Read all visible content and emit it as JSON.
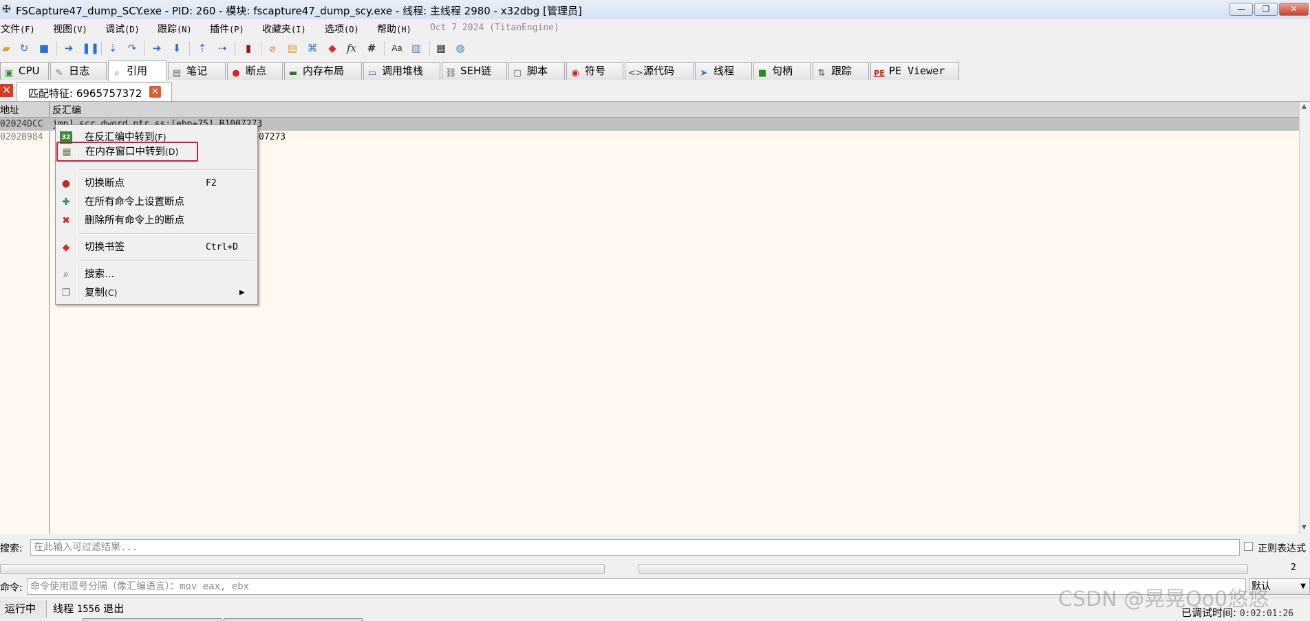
{
  "window": {
    "title": "FSCapture47_dump_SCY.exe - PID: 260 - 模块: fscapture47_dump_scy.exe - 线程: 主线程 2980 - x32dbg [管理员]",
    "buttons": [
      "minimize",
      "restore",
      "close"
    ]
  },
  "menubar": {
    "items": [
      {
        "label": "文件",
        "accel": "(F)"
      },
      {
        "label": "视图",
        "accel": "(V)"
      },
      {
        "label": "调试",
        "accel": "(D)"
      },
      {
        "label": "跟踪",
        "accel": "(N)"
      },
      {
        "label": "插件",
        "accel": "(P)"
      },
      {
        "label": "收藏夹",
        "accel": "(I)"
      },
      {
        "label": "选项",
        "accel": "(O)"
      },
      {
        "label": "帮助",
        "accel": "(H)"
      }
    ],
    "version": "Oct 7 2024 (TitanEngine)"
  },
  "toolbar": {
    "icons": [
      "open-icon",
      "restart-icon",
      "stop-icon",
      "run-icon",
      "pause-icon",
      "step-into-icon",
      "step-over-icon",
      "trace-into-icon",
      "trace-over-icon",
      "execute-till-return-icon",
      "run-to-user-code-icon",
      "scylla-icon",
      "patch-icon",
      "comment-icon",
      "label-icon",
      "bookmark-icon",
      "function-icon",
      "hash-icon",
      "strings-icon",
      "calculator-icon",
      "globe-icon"
    ]
  },
  "tabs": [
    {
      "label": "CPU",
      "icon": "cpu-icon",
      "glyph": "▣",
      "color": "#2a8f2a"
    },
    {
      "label": "日志",
      "icon": "log-icon",
      "glyph": "✎",
      "color": "#777"
    },
    {
      "label": "引用",
      "icon": "references-icon",
      "glyph": "⌕",
      "color": "#555"
    },
    {
      "label": "笔记",
      "icon": "notes-icon",
      "glyph": "▤",
      "color": "#666"
    },
    {
      "label": "断点",
      "icon": "breakpoints-icon",
      "glyph": "●",
      "color": "#d22"
    },
    {
      "label": "内存布局",
      "icon": "memory-map-icon",
      "glyph": "▬",
      "color": "#2a7a2a"
    },
    {
      "label": "调用堆栈",
      "icon": "call-stack-icon",
      "glyph": "▭",
      "color": "#2c5fb5"
    },
    {
      "label": "SEH链",
      "icon": "seh-chain-icon",
      "glyph": "⛓",
      "color": "#555"
    },
    {
      "label": "脚本",
      "icon": "script-icon",
      "glyph": "▢",
      "color": "#666"
    },
    {
      "label": "符号",
      "icon": "symbols-icon",
      "glyph": "◉",
      "color": "#c22"
    },
    {
      "label": "源代码",
      "icon": "source-icon",
      "glyph": "<>",
      "color": "#444"
    },
    {
      "label": "线程",
      "icon": "threads-icon",
      "glyph": "➤",
      "color": "#2a6fd1"
    },
    {
      "label": "句柄",
      "icon": "handles-icon",
      "glyph": "■",
      "color": "#2c8a2c"
    },
    {
      "label": "跟踪",
      "icon": "trace-icon",
      "glyph": "⇅",
      "color": "#555"
    },
    {
      "label": "PE Viewer",
      "icon": "pe-viewer-icon",
      "glyph": "PE",
      "color": "#c21"
    }
  ],
  "active_tab": "引用",
  "subtab": {
    "label": "匹配特征: 6965757372"
  },
  "table": {
    "columns": [
      "地址",
      "反汇编"
    ],
    "rows": [
      {
        "addr": "02024DCC",
        "dis": "jmp] scr_dword ptr ss:[ebp+75],B1007273",
        "selected": true
      },
      {
        "addr": "0202B984",
        "dis": "",
        "selected": false
      }
    ],
    "row2_tail": "07273",
    "row1_tail": "07273"
  },
  "context_menu": {
    "items": [
      {
        "icon": "goto-disassembly-icon",
        "glyph": "32",
        "label": "在反汇编中转到",
        "accel": "(F)",
        "shortcut": ""
      },
      {
        "icon": "goto-memory-icon",
        "glyph": "▦",
        "label": "在内存窗口中转到",
        "accel": "(D)",
        "shortcut": "",
        "highlighted": true
      },
      {
        "icon": "toggle-breakpoint-icon",
        "glyph": "●",
        "label": "切换断点",
        "accel": "",
        "shortcut": "F2"
      },
      {
        "icon": "set-breakpoint-all-icon",
        "glyph": "✚",
        "label": "在所有命令上设置断点",
        "accel": "",
        "shortcut": ""
      },
      {
        "icon": "remove-breakpoint-all-icon",
        "glyph": "✖",
        "label": "删除所有命令上的断点",
        "accel": "",
        "shortcut": ""
      },
      {
        "icon": "toggle-bookmark-icon",
        "glyph": "◆",
        "label": "切换书签",
        "accel": "",
        "shortcut": "Ctrl+D"
      },
      {
        "icon": "search-binoculars-icon",
        "glyph": "⌕",
        "label": "搜索...",
        "accel": "",
        "shortcut": ""
      },
      {
        "icon": "copy-icon",
        "glyph": "❐",
        "label": "复制",
        "accel": "(C)",
        "shortcut": "",
        "submenu": true
      }
    ]
  },
  "search": {
    "label": "搜索:",
    "placeholder": "在此输入可过滤结果...",
    "regex_label": "正则表达式"
  },
  "hscroll": {
    "count": "2"
  },
  "command": {
    "label": "命令:",
    "placeholder": "命令使用逗号分隔（像汇编语言）：mov eax, ebx",
    "mode": "默认"
  },
  "status": {
    "state": "运行中",
    "message_prefix": "线程",
    "thread_id": "1556",
    "message_suffix": "退出",
    "time_label": "已调试时间:",
    "time_value": "0:02:01:26"
  },
  "watermark": "CSDN @晃晃Qo0悠悠"
}
